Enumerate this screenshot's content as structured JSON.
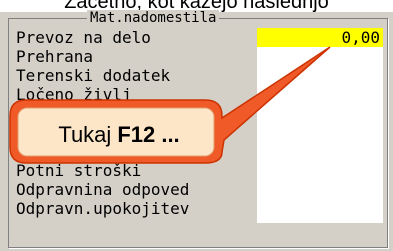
{
  "caption": "Začetno, kot kažejo naslednjo",
  "frame": {
    "title": "Mat.nadomestila",
    "rows": [
      {
        "label": "Prevoz na delo",
        "value": "0,00"
      },
      {
        "label": "Prehrana",
        "value": ""
      },
      {
        "label": "Terenski dodatek",
        "value": ""
      },
      {
        "label": "Ločeno življ",
        "value": ""
      },
      {
        "label": "",
        "value": ""
      },
      {
        "label": "",
        "value": ""
      },
      {
        "label": "",
        "value": ""
      },
      {
        "label": "Potni stroški",
        "value": ""
      },
      {
        "label": "Odpravnina odpoved",
        "value": ""
      },
      {
        "label": "Odpravn.upokojitev",
        "value": ""
      }
    ]
  },
  "callout": {
    "text": "Tukaj",
    "key": "F12 ...",
    "colors": {
      "fill": "#f05a28",
      "inner": "#fde6c8",
      "border": "#cc3300"
    }
  }
}
